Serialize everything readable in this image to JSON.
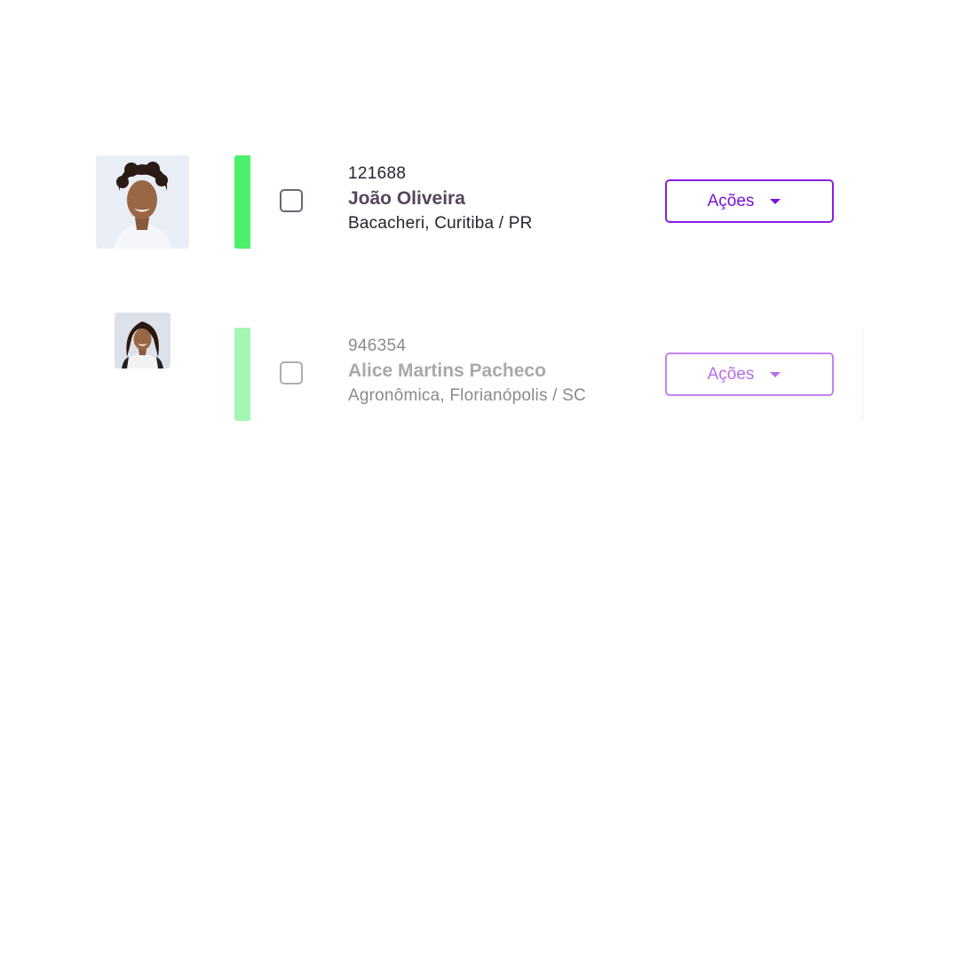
{
  "rows": [
    {
      "code": "121688",
      "name": "João Oliveira",
      "location": "Bacacheri, Curitiba / PR",
      "actions_label": "Ações",
      "status_color": "#4cef6b"
    },
    {
      "code": "946354",
      "name": "Alice Martins Pacheco",
      "location": "Agronômica, Florianópolis / SC",
      "actions_label": "Ações",
      "status_color": "#a5f5b4"
    }
  ],
  "colors": {
    "accent": "#8a1ee6",
    "accent_faded": "#c483f0"
  },
  "icons": {
    "dropdown": "caret-down-icon"
  }
}
